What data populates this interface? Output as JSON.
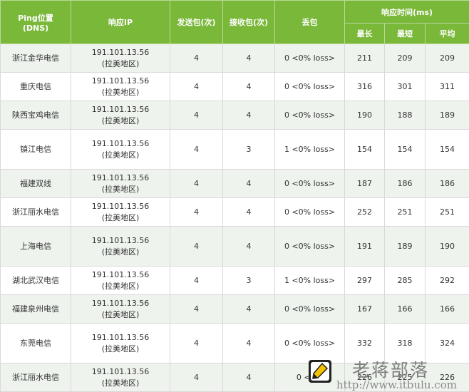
{
  "header": {
    "location_line1": "Ping位置",
    "location_line2": "(DNS)",
    "response_ip": "响应IP",
    "sent": "发送包(次)",
    "received": "接收包(次)",
    "lost": "丢包",
    "response_time": "响应时间(ms)",
    "max": "最长",
    "min": "最短",
    "avg": "平均"
  },
  "rows": [
    {
      "location": "浙江金华电信",
      "ip": "191.101.13.56",
      "region": "(拉美地区)",
      "sent": "4",
      "received": "4",
      "loss": "0 <0% loss>",
      "max": "211",
      "min": "209",
      "avg": "209"
    },
    {
      "location": "重庆电信",
      "ip": "191.101.13.56",
      "region": "(拉美地区)",
      "sent": "4",
      "received": "4",
      "loss": "0 <0% loss>",
      "max": "316",
      "min": "301",
      "avg": "311"
    },
    {
      "location": "陕西宝鸡电信",
      "ip": "191.101.13.56",
      "region": "(拉美地区)",
      "sent": "4",
      "received": "4",
      "loss": "0 <0% loss>",
      "max": "190",
      "min": "188",
      "avg": "189"
    },
    {
      "location": "镇江电信",
      "ip": "191.101.13.56",
      "region": "(拉美地区)",
      "sent": "4",
      "received": "3",
      "loss": "1 <0% loss>",
      "max": "154",
      "min": "154",
      "avg": "154"
    },
    {
      "location": "福建双线",
      "ip": "191.101.13.56",
      "region": "(拉美地区)",
      "sent": "4",
      "received": "4",
      "loss": "0 <0% loss>",
      "max": "187",
      "min": "186",
      "avg": "186"
    },
    {
      "location": "浙江丽水电信",
      "ip": "191.101.13.56",
      "region": "(拉美地区)",
      "sent": "4",
      "received": "4",
      "loss": "0 <0% loss>",
      "max": "252",
      "min": "251",
      "avg": "251"
    },
    {
      "location": "上海电信",
      "ip": "191.101.13.56",
      "region": "(拉美地区)",
      "sent": "4",
      "received": "4",
      "loss": "0 <0% loss>",
      "max": "191",
      "min": "189",
      "avg": "190"
    },
    {
      "location": "湖北武汉电信",
      "ip": "191.101.13.56",
      "region": "(拉美地区)",
      "sent": "4",
      "received": "3",
      "loss": "1 <0% loss>",
      "max": "297",
      "min": "285",
      "avg": "292"
    },
    {
      "location": "福建泉州电信",
      "ip": "191.101.13.56",
      "region": "(拉美地区)",
      "sent": "4",
      "received": "4",
      "loss": "0 <0% loss>",
      "max": "167",
      "min": "166",
      "avg": "166"
    },
    {
      "location": "东莞电信",
      "ip": "191.101.13.56",
      "region": "(拉美地区)",
      "sent": "4",
      "received": "4",
      "loss": "0 <0% loss>",
      "max": "332",
      "min": "318",
      "avg": "324"
    },
    {
      "location": "浙江丽水电信",
      "ip": "191.101.13.56",
      "region": "(拉美地区)",
      "sent": "4",
      "received": "4",
      "loss": "0 <0%",
      "max": "226",
      "min": "225",
      "avg": "226"
    }
  ],
  "watermark": {
    "title": "老蒋部落",
    "url": "http://www.itbulu.com"
  },
  "colors": {
    "header_bg": "#7ab83a",
    "row_alt_bg": "#eef3ed",
    "border": "#d9d9d9"
  }
}
